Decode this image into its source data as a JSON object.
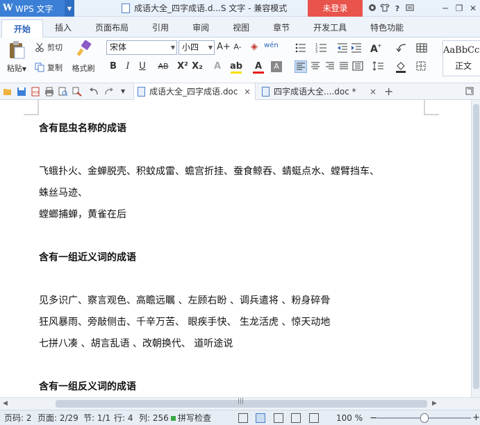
{
  "titlebar": {
    "app_name": "WPS 文字",
    "app_logo": "W",
    "doc_title": "成语大全_四字成语.d...S 文字 - 兼容模式",
    "login_label": "未登录",
    "icons": [
      "skin-icon",
      "shirt-icon",
      "help-icon",
      "settings-icon"
    ],
    "window_controls": [
      "minimize-icon",
      "maximize-icon",
      "close-icon"
    ]
  },
  "tabs": [
    "开始",
    "插入",
    "页面布局",
    "引用",
    "审阅",
    "视图",
    "章节",
    "开发工具",
    "特色功能"
  ],
  "active_tab": "开始",
  "ribbon": {
    "paste_label": "粘贴",
    "cut_label": "剪切",
    "copy_label": "复制",
    "format_painter_label": "格式刷",
    "font_name": "宋体",
    "font_size": "小四",
    "grow_font": "A+",
    "shrink_font": "A-",
    "pinyin": "wén",
    "bold": "B",
    "italic": "I",
    "underline": "U",
    "strikethrough": "AB",
    "superscript": "X²",
    "subscript": "X₂",
    "text_effect": "A",
    "highlight": "ab",
    "font_color": "A",
    "char_shading": "A",
    "style_preview": "AaBbCcD",
    "style_name": "正文",
    "highlight_color": "#f5e100",
    "font_color_value": "#e81b1b"
  },
  "doc_tabs": [
    {
      "label": "成语大全_四字成语.doc",
      "close": "×",
      "active": true
    },
    {
      "label": "四字成语大全....doc *",
      "close": "×",
      "active": false
    }
  ],
  "new_tab_label": "+",
  "document": {
    "lines": [
      {
        "text": "含有昆虫名称的成语",
        "heading": true
      },
      {
        "text": "",
        "heading": false
      },
      {
        "text": "飞蛾扑火、金蝉脱壳、积蚊成雷、蟾宫折挂、蚕食鲸吞、蜻蜓点水、螳臂挡车、",
        "heading": false
      },
      {
        "text": "蛛丝马迹、",
        "heading": false
      },
      {
        "text": "螳螂捕蝉，黄雀在后",
        "heading": false
      },
      {
        "text": "",
        "heading": false
      },
      {
        "text": "含有一组近义词的成语",
        "heading": true
      },
      {
        "text": "",
        "heading": false
      },
      {
        "text": "见多识广、察言观色、高瞻远瞩 、左顾右盼 、调兵遣将 、粉身碎骨",
        "heading": false
      },
      {
        "text": "狂风暴雨、旁敲侧击、千辛万苦、 眼疾手快、 生龙活虎 、惊天动地",
        "heading": false
      },
      {
        "text": "七拼八凑 、胡言乱语 、改朝换代、 道听途说",
        "heading": false
      },
      {
        "text": "",
        "heading": false
      },
      {
        "text": "含有一组反义词的成语",
        "heading": true
      }
    ]
  },
  "statusbar": {
    "page_num": "页码: 2",
    "pages": "页面: 2/29",
    "section": "节: 1/1",
    "line": "行: 4",
    "column": "列: 256",
    "spell_check": "拼写检查",
    "zoom": "100 %",
    "zoom_minus": "−",
    "zoom_plus": "+",
    "zoom_level": 0.5
  }
}
